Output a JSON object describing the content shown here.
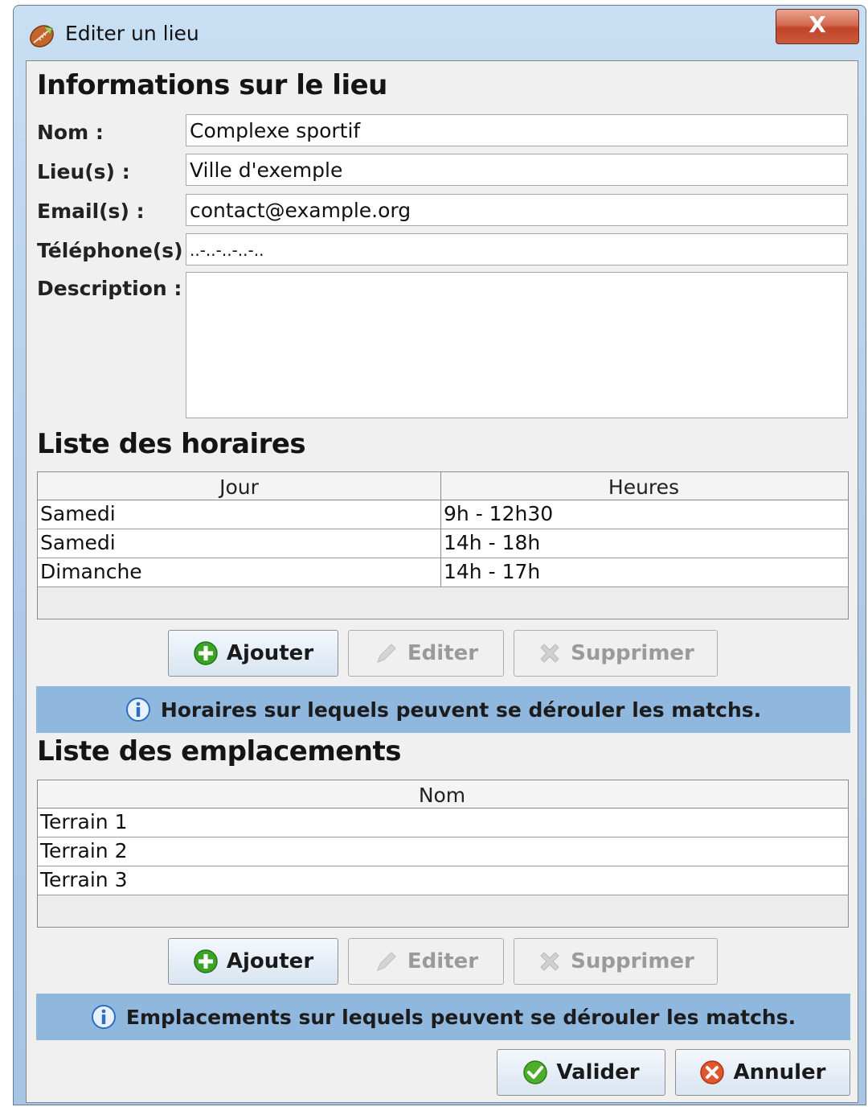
{
  "window": {
    "title": "Editer un lieu",
    "close_label": "X"
  },
  "info_section": {
    "title": "Informations sur le lieu",
    "fields": {
      "nom": {
        "label": "Nom :",
        "value": "Complexe sportif"
      },
      "lieux": {
        "label": "Lieu(s) :",
        "value": "Ville d'exemple"
      },
      "emails": {
        "label": "Email(s) :",
        "value": "contact@example.org"
      },
      "telephones": {
        "label": "Téléphone(s) :",
        "value": "..-..-..-..-.."
      },
      "description": {
        "label": "Description :",
        "value": ""
      }
    }
  },
  "horaires": {
    "title": "Liste des horaires",
    "columns": [
      "Jour",
      "Heures"
    ],
    "rows": [
      [
        "Samedi",
        "9h - 12h30"
      ],
      [
        "Samedi",
        "14h - 18h"
      ],
      [
        "Dimanche",
        "14h - 17h"
      ]
    ],
    "buttons": {
      "add": "Ajouter",
      "edit": "Editer",
      "delete": "Supprimer"
    },
    "info": "Horaires sur lequels peuvent se dérouler les matchs."
  },
  "emplacements": {
    "title": "Liste des emplacements",
    "columns": [
      "Nom"
    ],
    "rows": [
      [
        "Terrain 1"
      ],
      [
        "Terrain 2"
      ],
      [
        "Terrain 3"
      ]
    ],
    "buttons": {
      "add": "Ajouter",
      "edit": "Editer",
      "delete": "Supprimer"
    },
    "info": "Emplacements sur lequels peuvent se dérouler les matchs."
  },
  "footer": {
    "validate": "Valider",
    "cancel": "Annuler"
  },
  "icons": {
    "app": "ball-icon",
    "add": "plus-circle-icon",
    "edit": "pencil-icon",
    "delete": "x-cross-icon",
    "info": "info-icon",
    "validate": "check-circle-icon",
    "cancel": "x-circle-icon"
  },
  "colors": {
    "info_bar": "#90b7de",
    "add_icon": "#3aa524",
    "validate_icon": "#4cae2a",
    "cancel_icon": "#e0552c",
    "close_button": "#c94d33"
  }
}
